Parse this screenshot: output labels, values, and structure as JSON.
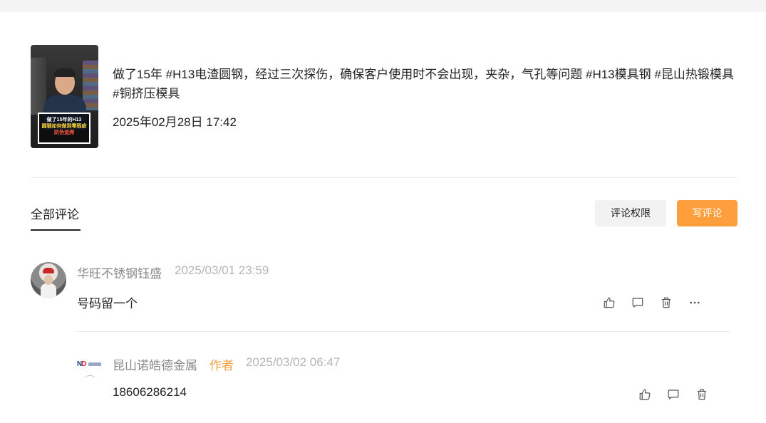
{
  "post": {
    "thumbnail": {
      "caption_line1": "做了15年的H13",
      "caption_line2": "圆钢如何做到零瑕疵",
      "caption_line3": "防伪追溯"
    },
    "text": "做了15年 #H13电渣圆钢，经过三次探伤，确保客户使用时不会出现，夹杂，气孔等问题 #H13模具钢 #昆山热锻模具 #铜挤压模具",
    "time": "2025年02月28日 17:42"
  },
  "comments_section": {
    "tab_label": "全部评论",
    "permission_button": "评论权限",
    "write_button": "写评论"
  },
  "comments": [
    {
      "user": "华旺不锈钢钰盛",
      "time": "2025/03/01 23:59",
      "text": "号码留一个",
      "actions": [
        "thumbs-up-icon",
        "comment-icon",
        "trash-icon",
        "more-icon"
      ]
    }
  ],
  "replies": [
    {
      "user": "昆山诺皓德金属",
      "badge": "作者",
      "time": "2025/03/02 06:47",
      "text": "18606286214",
      "actions": [
        "thumbs-up-icon",
        "comment-icon",
        "trash-icon"
      ]
    }
  ],
  "colors": {
    "accent": "#ff9e3d",
    "author_badge": "#f0a040",
    "muted": "#888888"
  }
}
